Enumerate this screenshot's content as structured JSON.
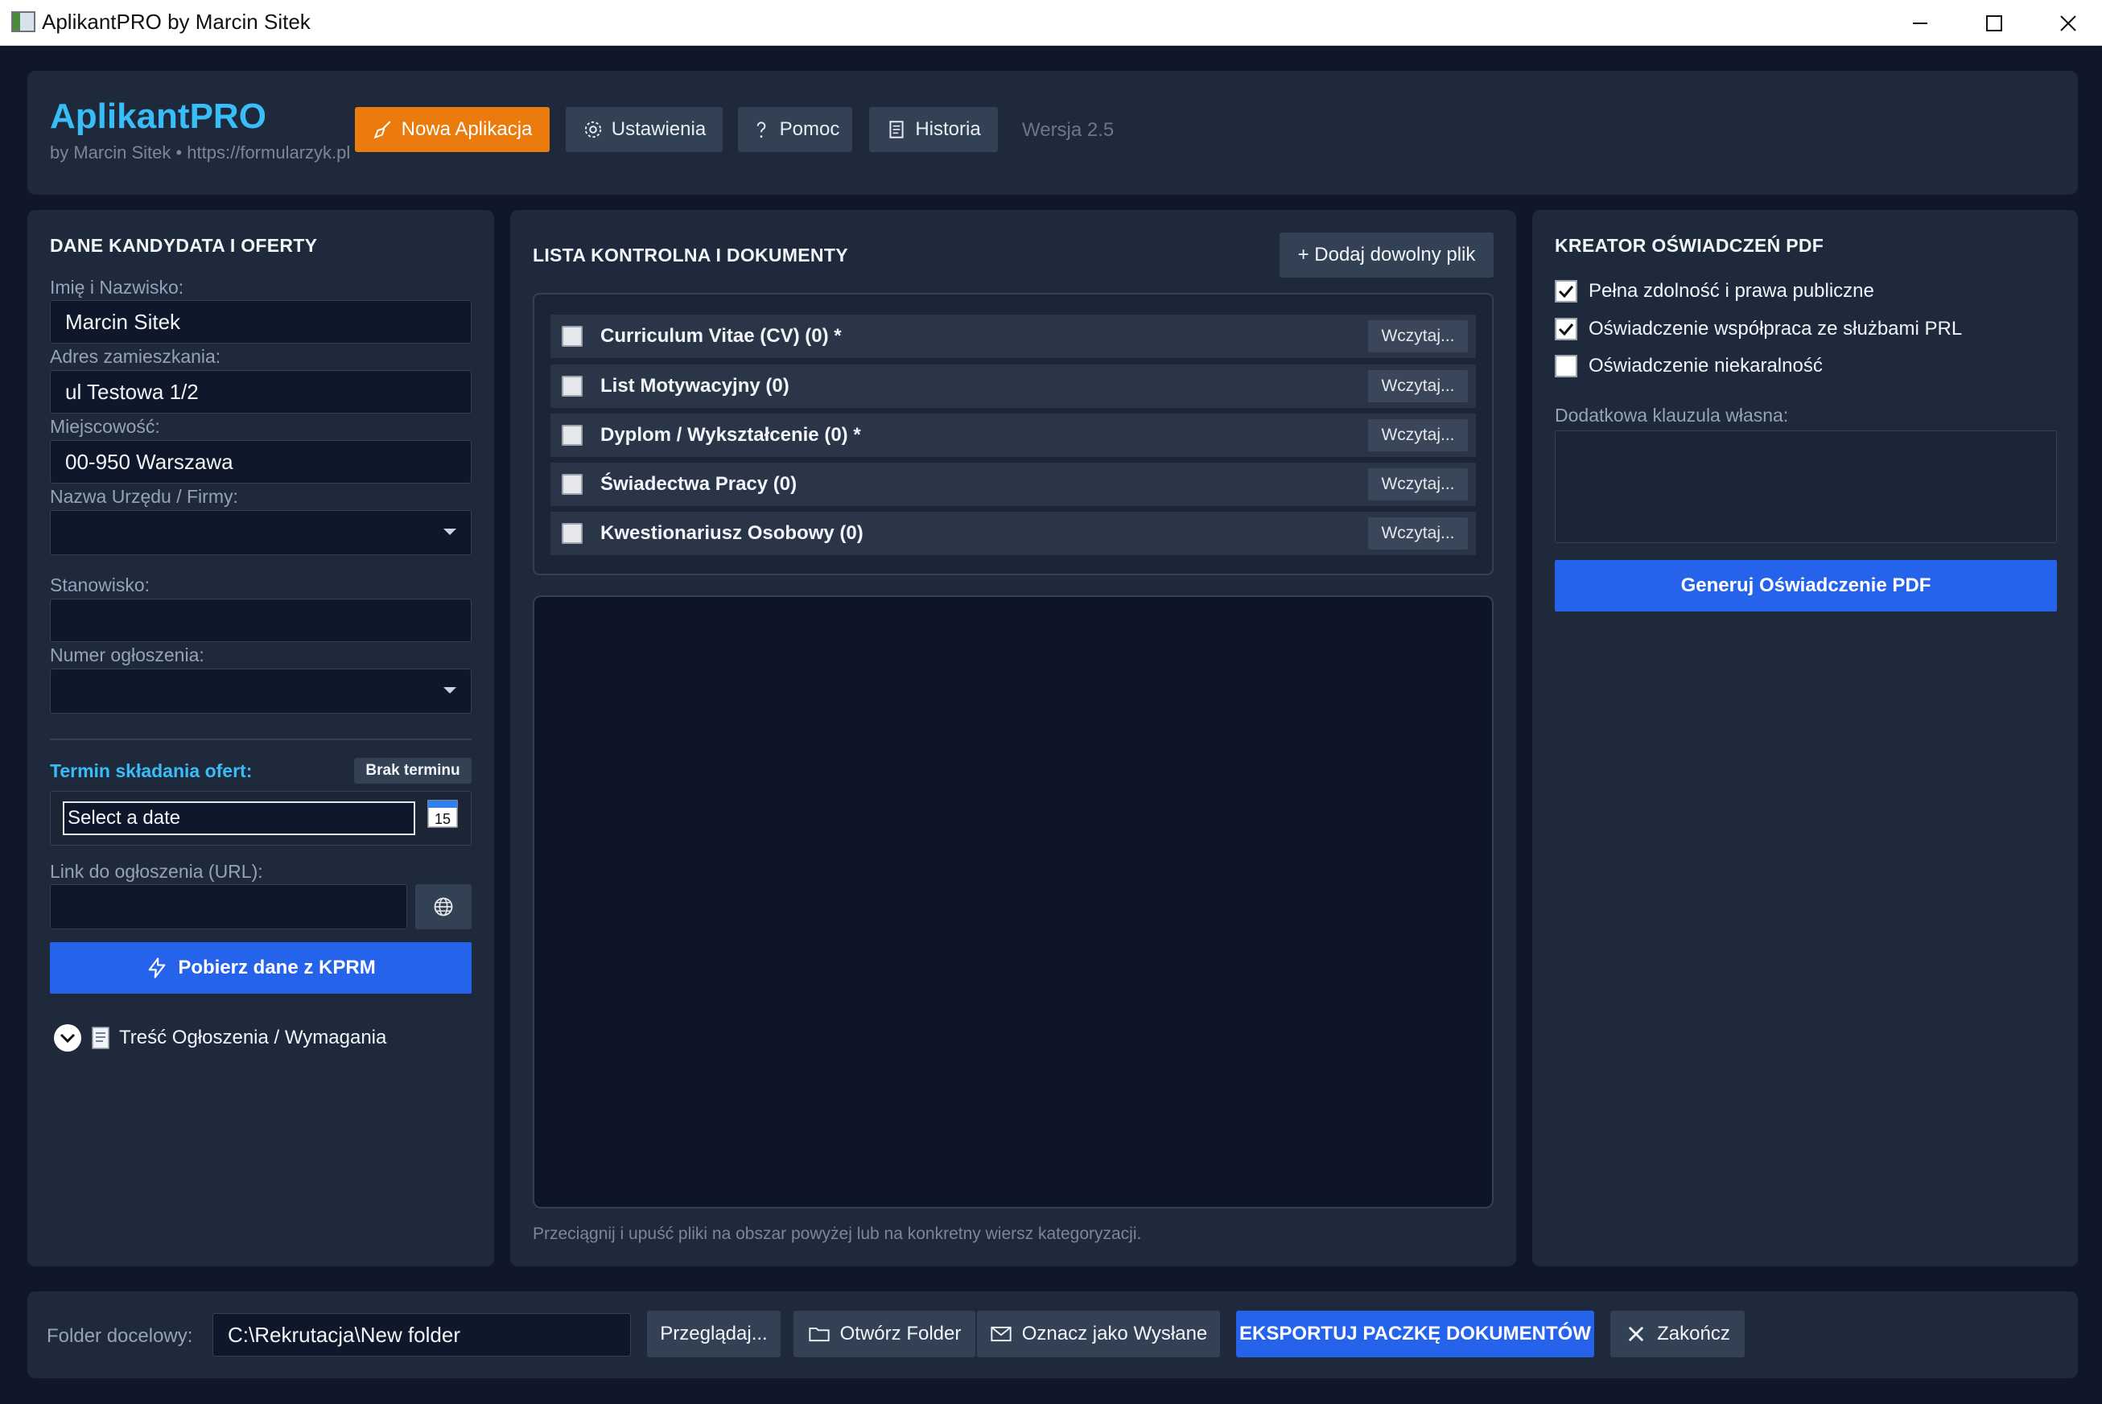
{
  "window": {
    "title": "AplikantPRO by Marcin Sitek"
  },
  "header": {
    "brand": "AplikantPRO",
    "subtitle": "by Marcin Sitek • https://formularzyk.pl",
    "buttons": {
      "new_app": "Nowa Aplikacja",
      "settings": "Ustawienia",
      "help": "Pomoc",
      "history": "Historia"
    },
    "version": "Wersja 2.5",
    "accent_color": "#ea7b0c",
    "brand_color": "#38bdf8"
  },
  "left": {
    "title": "DANE KANDYDATA I OFERTY",
    "name_label": "Imię i Nazwisko:",
    "name_value": "Marcin Sitek",
    "address_label": "Adres zamieszkania:",
    "address_value": "ul Testowa 1/2",
    "city_label": "Miejscowość:",
    "city_value": "00-950 Warszawa",
    "office_label": "Nazwa Urzędu / Firmy:",
    "office_value": "",
    "position_label": "Stanowisko:",
    "position_value": "",
    "ad_number_label": "Numer ogłoszenia:",
    "ad_number_value": "",
    "deadline_label": "Termin składania ofert:",
    "no_deadline": "Brak terminu",
    "date_placeholder": "Select a date",
    "calendar_day": "15",
    "url_label": "Link do ogłoszenia (URL):",
    "url_value": "",
    "fetch_button": "Pobierz dane z KPRM",
    "requirements_toggle": "Treść Ogłoszenia / Wymagania"
  },
  "middle": {
    "title": "LISTA KONTROLNA I DOKUMENTY",
    "add_file_button": "+ Dodaj dowolny plik",
    "load_label": "Wczytaj...",
    "items": [
      {
        "label": "Curriculum Vitae (CV) (0) *",
        "checked": false
      },
      {
        "label": "List Motywacyjny (0)",
        "checked": false
      },
      {
        "label": "Dyplom / Wykształcenie (0) *",
        "checked": false
      },
      {
        "label": "Świadectwa Pracy (0)",
        "checked": false
      },
      {
        "label": "Kwestionariusz Osobowy (0)",
        "checked": false
      }
    ],
    "hint": "Przeciągnij i upuść pliki na obszar powyżej lub na konkretny wiersz kategoryzacji."
  },
  "right": {
    "title": "KREATOR OŚWIADCZEŃ PDF",
    "options": [
      {
        "label": "Pełna zdolność i prawa publiczne",
        "checked": true
      },
      {
        "label": "Oświadczenie współpraca ze służbami PRL",
        "checked": true
      },
      {
        "label": "Oświadczenie niekaralność",
        "checked": false
      }
    ],
    "clause_label": "Dodatkowa klauzula własna:",
    "clause_value": "",
    "generate_button": "Generuj Oświadczenie PDF"
  },
  "footer": {
    "folder_label": "Folder docelowy:",
    "folder_value": "C:\\Rekrutacja\\New folder",
    "browse": "Przeglądaj...",
    "open_folder": "Otwórz Folder",
    "mark_sent": "Oznacz jako Wysłane",
    "export": "EKSPORTUJ PACZKĘ DOKUMENTÓW",
    "close": "Zakończ"
  }
}
